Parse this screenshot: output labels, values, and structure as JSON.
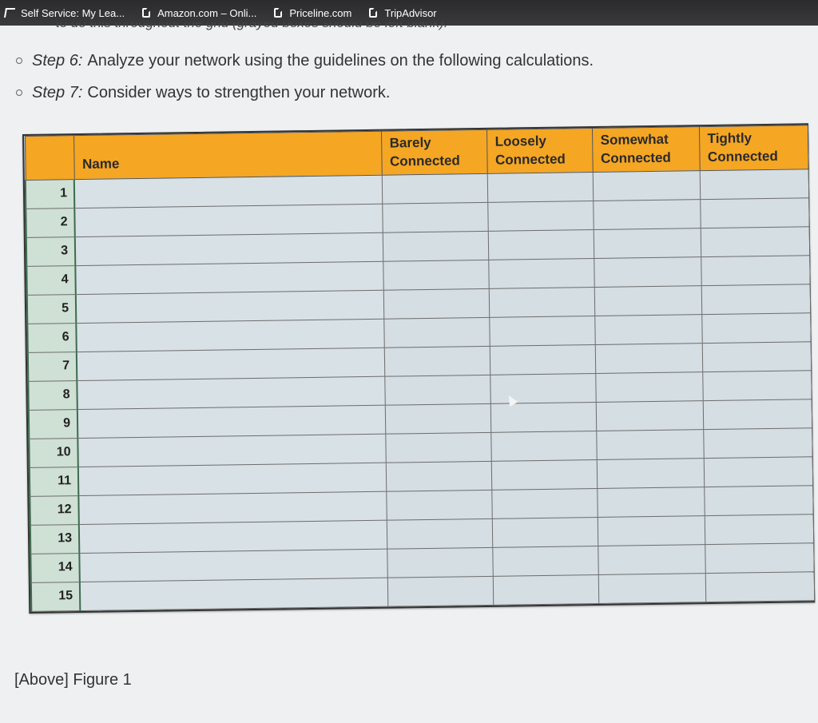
{
  "bookmarks": [
    {
      "label": "Self Service: My Lea...",
      "icon": "self-service-icon"
    },
    {
      "label": "Amazon.com – Onli...",
      "icon": "bookmark-page-icon"
    },
    {
      "label": "Priceline.com",
      "icon": "bookmark-page-icon"
    },
    {
      "label": "TripAdvisor",
      "icon": "bookmark-page-icon"
    }
  ],
  "clipped_text": "to do this throughout the grid (grayed boxes should be left blank).",
  "steps": [
    {
      "label": "Step 6:",
      "text": "Analyze your network using the guidelines on the following calculations."
    },
    {
      "label": "Step 7:",
      "text": "Consider ways to strengthen your network."
    }
  ],
  "table": {
    "headers": {
      "number": "",
      "name": "Name",
      "barely": "Barely Connected",
      "loosely": "Loosely Connected",
      "somewhat": "Somewhat Connected",
      "tightly": "Tightly Connected"
    },
    "rows": [
      "1",
      "2",
      "3",
      "4",
      "5",
      "6",
      "7",
      "8",
      "9",
      "10",
      "11",
      "12",
      "13",
      "14",
      "15"
    ]
  },
  "caption": "[Above] Figure 1",
  "colors": {
    "header": "#f5a623",
    "row_number_bg": "#cfe0d5",
    "cell_bg": "#d4dee3",
    "bookmark_bar": "#2b2b2e"
  }
}
